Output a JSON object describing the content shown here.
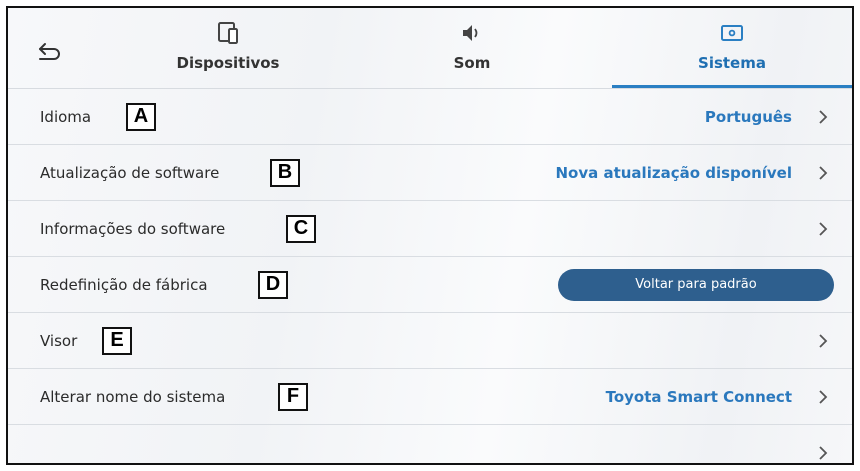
{
  "header": {
    "tabs": [
      {
        "label": "Dispositivos",
        "icon": "phone-tablet-icon",
        "active": false
      },
      {
        "label": "Som",
        "icon": "speaker-icon",
        "active": false
      },
      {
        "label": "Sistema",
        "icon": "system-screen-icon",
        "active": true
      }
    ],
    "back_icon": "back-arrow-icon"
  },
  "rows": [
    {
      "label": "Idioma",
      "value": "Português",
      "callout": "A"
    },
    {
      "label": "Atualização de software",
      "value": "Nova atualização disponível",
      "callout": "B"
    },
    {
      "label": "Informações do software",
      "value": "",
      "callout": "C"
    },
    {
      "label": "Redefinição de fábrica",
      "button": "Voltar para padrão",
      "callout": "D"
    },
    {
      "label": "Visor",
      "value": "",
      "callout": "E"
    },
    {
      "label": "Alterar nome do sistema",
      "value": "Toyota Smart Connect",
      "callout": "F"
    },
    {
      "label": "",
      "value": ""
    }
  ],
  "colors": {
    "accent": "#2a7fc3",
    "value_text": "#2a78bd",
    "button_bg": "#2e5f8e"
  }
}
